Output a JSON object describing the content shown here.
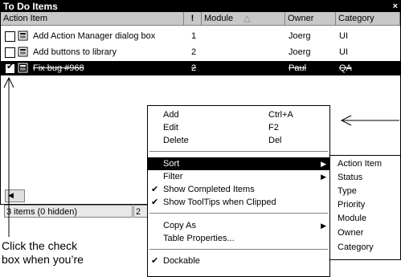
{
  "panel": {
    "title": "To Do Items",
    "close_glyph": "×",
    "columns": [
      "Action Item",
      "!",
      "Module",
      "Owner",
      "Category"
    ],
    "sort_indicator": "△",
    "rows": [
      {
        "checked": false,
        "action": "Add Action Manager dialog box",
        "priority": "1",
        "module": "",
        "owner": "Joerg",
        "category": "UI"
      },
      {
        "checked": false,
        "action": "Add buttons to library",
        "priority": "2",
        "module": "",
        "owner": "Joerg",
        "category": "UI"
      },
      {
        "checked": true,
        "action": "Fix bug #968",
        "priority": "2",
        "module": "",
        "owner": "Paul",
        "category": "QA"
      }
    ],
    "status_left": "3 items (0 hidden)",
    "status_right": "2"
  },
  "context_menu": {
    "items": [
      {
        "label": "Add",
        "shortcut": "Ctrl+A"
      },
      {
        "label": "Edit",
        "shortcut": "F2"
      },
      {
        "label": "Delete",
        "shortcut": "Del"
      },
      {
        "label": "Sort",
        "submenu": true,
        "highlighted": true
      },
      {
        "label": "Filter",
        "submenu": true
      },
      {
        "label": "Show Completed Items",
        "checked": true
      },
      {
        "label": "Show ToolTips when Clipped",
        "checked": true
      },
      {
        "label": "Copy As",
        "submenu": true
      },
      {
        "label": "Table Properties..."
      },
      {
        "label": "Dockable",
        "checked": true
      }
    ]
  },
  "sort_submenu": {
    "items": [
      "Action Item",
      "Status",
      "Type",
      "Priority",
      "Module",
      "Owner",
      "Category"
    ]
  },
  "caption": {
    "line1": "Click the check",
    "line2": "box when you’re"
  },
  "colors": {
    "selection": "#000000",
    "header": "#c8c8c8",
    "status": "#e8e8e8"
  }
}
